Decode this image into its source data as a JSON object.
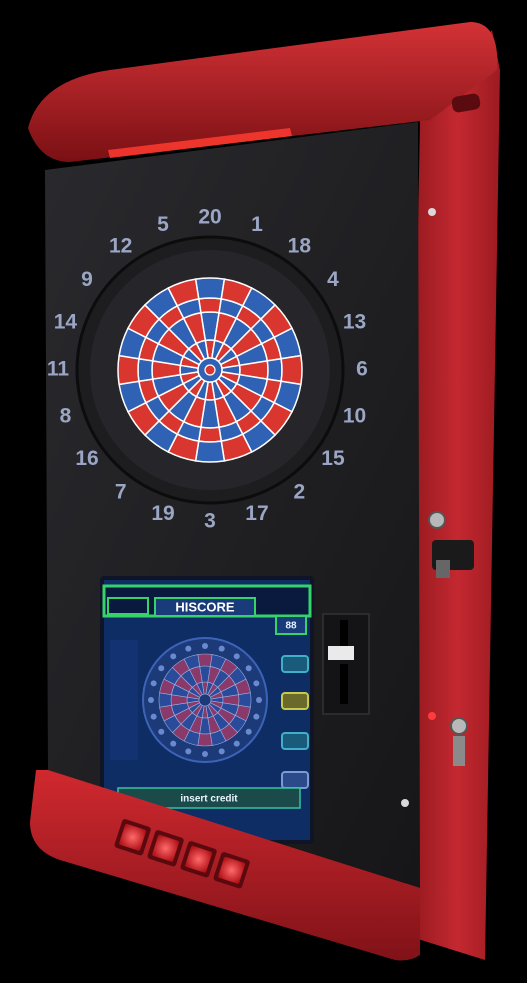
{
  "image": {
    "subject": "electronic-dartboard-machine",
    "background_color": "#000000",
    "cabinet_color": "#c4202a"
  },
  "dartboard": {
    "numbers": [
      "20",
      "1",
      "18",
      "4",
      "13",
      "6",
      "10",
      "15",
      "2",
      "17",
      "3",
      "19",
      "7",
      "16",
      "8",
      "11",
      "14",
      "9",
      "12",
      "5"
    ],
    "colors": {
      "red": "#d8362e",
      "blue": "#2f62b4",
      "wire": "#ffffff",
      "surround": "#1d1d20"
    }
  },
  "screen": {
    "title": "HISCORE",
    "badge": "88",
    "footer": "insert credit",
    "colors": {
      "frame": "#36d36b",
      "panel": "#1b3d8a"
    }
  },
  "buttons": {
    "count": 4,
    "color": "#e0262c"
  }
}
